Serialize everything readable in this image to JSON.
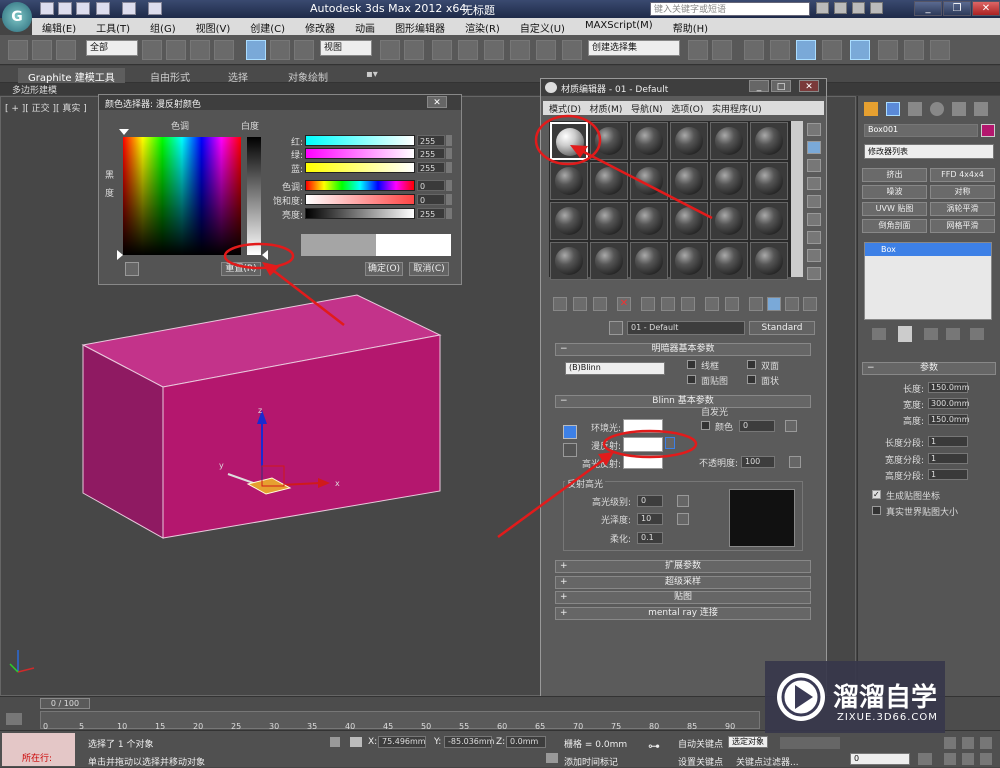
{
  "window": {
    "title": "Autodesk 3ds Max  2012 x64",
    "file": "无标题",
    "search_placeholder": "键入关键字或短语",
    "controls": [
      "_",
      "❐",
      "✕"
    ]
  },
  "menu": [
    "编辑(E)",
    "工具(T)",
    "组(G)",
    "视图(V)",
    "创建(C)",
    "修改器",
    "动画",
    "图形编辑器",
    "渲染(R)",
    "自定义(U)",
    "MAXScript(M)",
    "帮助(H)"
  ],
  "toolbar": {
    "selection_filter": "全部",
    "ref_coord": "视图",
    "named_selection": "创建选择集"
  },
  "ribbon": {
    "tabs": [
      "Graphite 建模工具",
      "自由形式",
      "选择",
      "对象绘制"
    ],
    "sub_label": "多边形建模"
  },
  "viewport": {
    "label": "[ + ][ 正交 ][ 真实 ]"
  },
  "color_picker": {
    "title": "颜色选择器: 漫反射颜色",
    "hue_label": "色调",
    "whiteness_label": "白度",
    "blackness_label": "黑\n度",
    "rows": [
      {
        "label": "红:",
        "value": "255"
      },
      {
        "label": "绿:",
        "value": "255"
      },
      {
        "label": "蓝:",
        "value": "255"
      },
      {
        "label": "色调:",
        "value": "0"
      },
      {
        "label": "饱和度:",
        "value": "0"
      },
      {
        "label": "亮度:",
        "value": "255"
      }
    ],
    "reset_button": "重置(R)",
    "ok_button": "确定(O)",
    "cancel_button": "取消(C)",
    "close": "✕"
  },
  "material_editor": {
    "title": "材质编辑器 - 01 - Default",
    "menus": [
      "模式(D)",
      "材质(M)",
      "导航(N)",
      "选项(O)",
      "实用程序(U)"
    ],
    "material_name": "01 - Default",
    "material_type": "Standard",
    "shader_rollout": "明暗器基本参数",
    "shader": "(B)Blinn",
    "shader_opts": [
      "线框",
      "双面",
      "面贴图",
      "面状"
    ],
    "blinn_rollout": "Blinn 基本参数",
    "self_illum_label": "自发光",
    "color_label": "颜色",
    "self_illum_value": "0",
    "ambient_label": "环境光:",
    "diffuse_label": "漫反射:",
    "specular_label": "高光反射:",
    "opacity_label": "不透明度:",
    "opacity_value": "100",
    "spec_group": "反射高光",
    "spec_level_label": "高光级别:",
    "spec_level": "0",
    "gloss_label": "光泽度:",
    "gloss": "10",
    "soften_label": "柔化:",
    "soften": "0.1",
    "rollouts": [
      "扩展参数",
      "超级采样",
      "贴图",
      "mental ray 连接"
    ]
  },
  "command_panel": {
    "object_name": "Box001",
    "modifier_list": "修改器列表",
    "buttons": [
      "挤出",
      "FFD 4x4x4",
      "噪波",
      "对称",
      "UVW 贴图",
      "涡轮平滑",
      "倒角剖面",
      "网格平滑"
    ],
    "stack_item": "Box",
    "params_title": "参数",
    "length_label": "长度:",
    "length": "150.0mm",
    "width_label": "宽度:",
    "width": "300.0mm",
    "height_label": "高度:",
    "height": "150.0mm",
    "length_segs_label": "长度分段:",
    "length_segs": "1",
    "width_segs_label": "宽度分段:",
    "width_segs": "1",
    "height_segs_label": "高度分段:",
    "height_segs": "1",
    "gen_map_coords": "生成贴图坐标",
    "real_world": "真实世界贴图大小"
  },
  "timeline": {
    "frame": "0 / 100",
    "ticks": [
      "0",
      "5",
      "10",
      "15",
      "20",
      "25",
      "30",
      "35",
      "40",
      "45",
      "50",
      "55",
      "60",
      "65",
      "70",
      "75",
      "80",
      "85",
      "90"
    ]
  },
  "status": {
    "maxscript": "所在行:",
    "selected": "选择了 1 个对象",
    "prompt": "单击并拖动以选择并移动对象",
    "x_label": "X:",
    "x": "75.496mm",
    "y_label": "Y:",
    "y": "-85.036mm",
    "z_label": "Z:",
    "z": "0.0mm",
    "grid": "栅格 = 0.0mm",
    "add_time_tag": "添加时间标记",
    "auto_key": "自动关键点",
    "set_key": "设置关键点",
    "selected_obj": "选定对象",
    "key_filters": "关键点过滤器...",
    "frame_field": "0"
  },
  "watermark": {
    "title": "溜溜自学",
    "subtitle": "ZIXUE.3D66.COM"
  },
  "colors": {
    "box": "#b4176e",
    "annotation": "#e21b1b",
    "selection_blue": "#3d80e6"
  }
}
